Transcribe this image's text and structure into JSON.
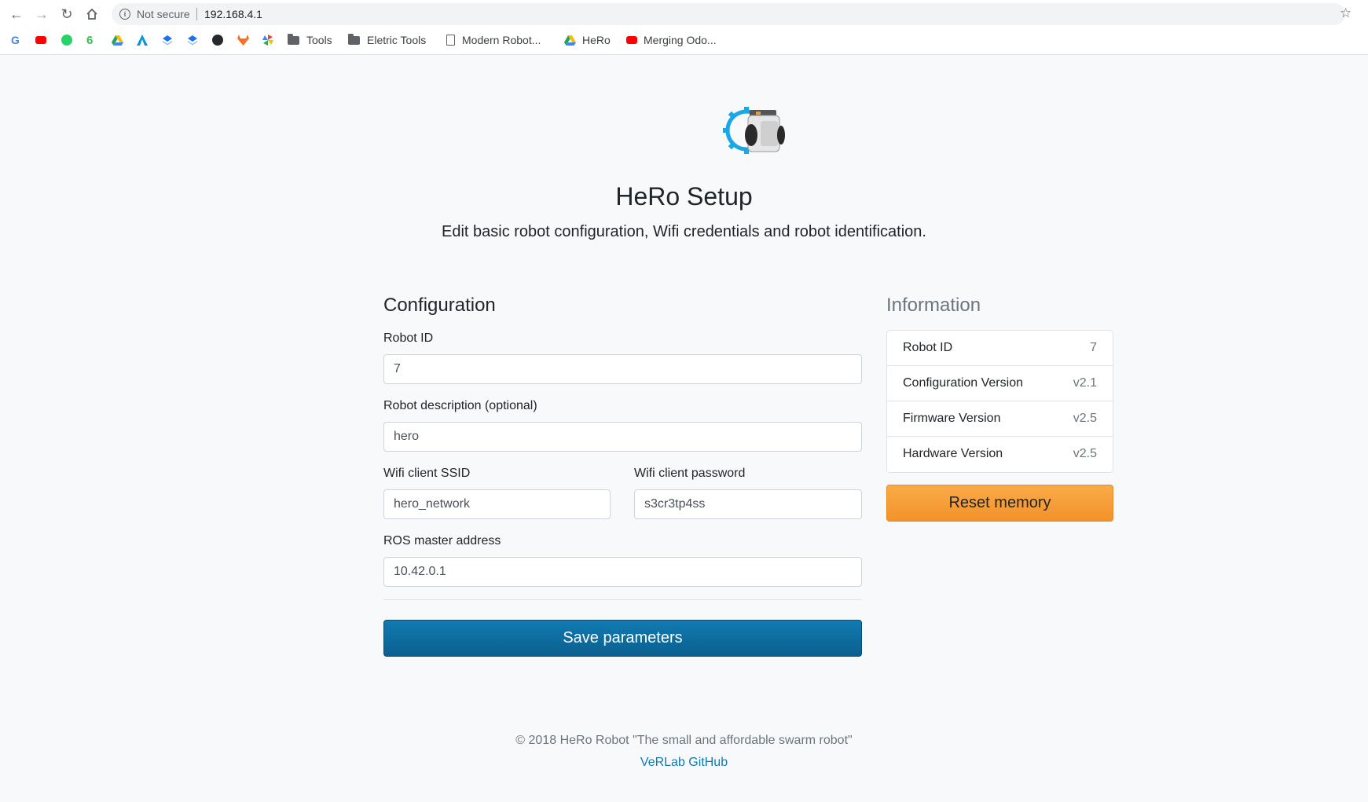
{
  "browser": {
    "security_label": "Not secure",
    "url": "192.168.4.1",
    "bookmarks": [
      {
        "label": "",
        "icon": "google-icon",
        "color": "#4285f4"
      },
      {
        "label": "",
        "icon": "youtube-icon",
        "color": "#ff0000"
      },
      {
        "label": "",
        "icon": "whatsapp-icon",
        "color": "#25d366"
      },
      {
        "label": "",
        "icon": "leaf-icon",
        "color": "#3cba54"
      },
      {
        "label": "",
        "icon": "drive-icon",
        "color": "#fbbc04"
      },
      {
        "label": "",
        "icon": "autodesk-icon",
        "color": "#0696d7"
      },
      {
        "label": "",
        "icon": "stack-icon-1",
        "color": "#1a73e8"
      },
      {
        "label": "",
        "icon": "stack-icon-2",
        "color": "#1a73e8"
      },
      {
        "label": "",
        "icon": "github-icon",
        "color": "#24292e"
      },
      {
        "label": "",
        "icon": "gitlab-icon",
        "color": "#fc6d26"
      },
      {
        "label": "",
        "icon": "pinwheel-icon",
        "color": "#ea4335"
      },
      {
        "label": "Tools",
        "icon": "folder-icon"
      },
      {
        "label": "Eletric Tools",
        "icon": "folder-icon"
      },
      {
        "label": "Modern Robot...",
        "icon": "document-icon"
      },
      {
        "label": "HeRo",
        "icon": "drive-icon"
      },
      {
        "label": "Merging Odo...",
        "icon": "youtube-icon"
      }
    ]
  },
  "header": {
    "title": "HeRo Setup",
    "lead": "Edit basic robot configuration, Wifi credentials and robot identification."
  },
  "config": {
    "title": "Configuration",
    "robot_id_label": "Robot ID",
    "robot_id_value": "7",
    "description_label": "Robot description (optional)",
    "description_value": "hero",
    "ssid_label": "Wifi client SSID",
    "ssid_value": "hero_network",
    "password_label": "Wifi client password",
    "password_value": "s3cr3tp4ss",
    "ros_label": "ROS master address",
    "ros_value": "10.42.0.1",
    "save_label": "Save parameters"
  },
  "info": {
    "title": "Information",
    "rows": [
      {
        "key": "Robot ID",
        "value": "7"
      },
      {
        "key": "Configuration Version",
        "value": "v2.1"
      },
      {
        "key": "Firmware Version",
        "value": "v2.5"
      },
      {
        "key": "Hardware Version",
        "value": "v2.5"
      }
    ],
    "reset_label": "Reset memory"
  },
  "footer": {
    "copyright": "© 2018 HeRo Robot \"The small and affordable swarm robot\"",
    "link": "VeRLab GitHub"
  },
  "colors": {
    "primary": "#117bb2",
    "warning": "#f7a13a",
    "gear": "#1aa7e8"
  }
}
